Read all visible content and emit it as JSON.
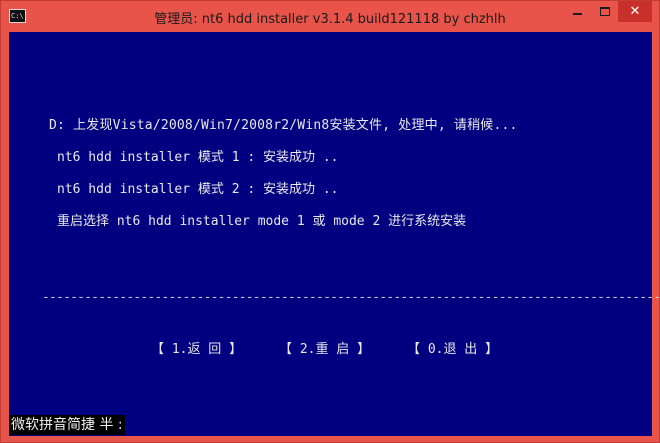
{
  "window": {
    "title": "管理员:  nt6 hdd installer v3.1.4 build121118 by chzhlh",
    "icon_label": "C:\\",
    "controls": {
      "minimize": "minimize-icon",
      "maximize": "maximize-icon",
      "close": "✕"
    }
  },
  "colors": {
    "titlebar": "#e8534a",
    "console_bg": "#000080",
    "text": "#e8e8e8",
    "close_bg": "#c9302c"
  },
  "console": {
    "lines": [
      "D: 上发现Vista/2008/Win7/2008r2/Win8安装文件, 处理中, 请稍候...",
      "nt6 hdd installer 模式 1 : 安装成功 ..",
      "nt6 hdd installer 模式 2 : 安装成功 ..",
      "重启选择 nt6 hdd installer mode 1 或 mode 2 进行系统安装"
    ],
    "divider": "------------------------------------------------------------------------------------------",
    "menu": [
      "【 1.返 回 】",
      "【 2.重 启 】",
      "【 0.退 出 】"
    ],
    "ime_status": "微软拼音简捷 半 :"
  }
}
